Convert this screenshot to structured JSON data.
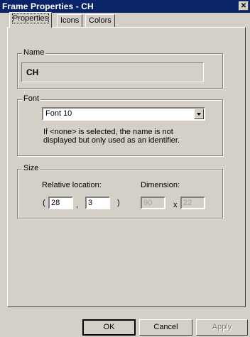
{
  "window": {
    "title": "Frame Properties - CH",
    "close_glyph": "✕"
  },
  "tabs": [
    {
      "label": "Properties",
      "active": true
    },
    {
      "label": "Icons",
      "active": false
    },
    {
      "label": "Colors",
      "active": false
    }
  ],
  "name_group": {
    "legend": "Name",
    "value": "CH"
  },
  "font_group": {
    "legend": "Font",
    "selected": "Font 10",
    "hint": "If <none> is selected, the name is not displayed but only used as an identifier."
  },
  "size_group": {
    "legend": "Size",
    "relative_location_label": "Relative location:",
    "dimension_label": "Dimension:",
    "open_paren": "(",
    "comma": ",",
    "close_paren": ")",
    "x_separator": "x",
    "loc_x": "28",
    "loc_y": "3",
    "dim_w": "90",
    "dim_h": "22"
  },
  "buttons": {
    "ok": "OK",
    "cancel": "Cancel",
    "apply": "Apply"
  }
}
